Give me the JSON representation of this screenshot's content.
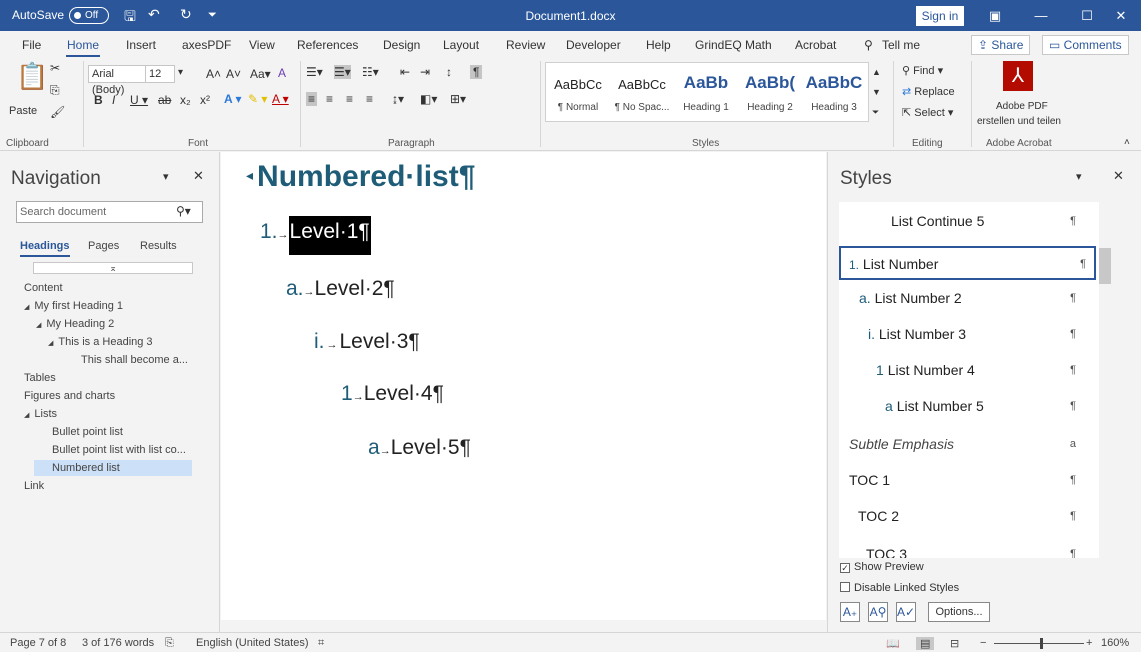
{
  "titlebar": {
    "autosave_label": "AutoSave",
    "autosave_state": "Off",
    "document_title": "Document1.docx",
    "sign_in": "Sign in"
  },
  "tabs": [
    "File",
    "Home",
    "Insert",
    "axesPDF",
    "View",
    "References",
    "Design",
    "Layout",
    "Review",
    "Developer",
    "Help",
    "GrindEQ Math",
    "Acrobat",
    "Tell me"
  ],
  "share_label": "Share",
  "comments_label": "Comments",
  "ribbon": {
    "paste": "Paste",
    "font_name": "Arial (Body)",
    "font_size": "12",
    "groups": {
      "clipboard": "Clipboard",
      "font": "Font",
      "paragraph": "Paragraph",
      "styles": "Styles",
      "editing": "Editing",
      "acrobat": "Adobe Acrobat"
    },
    "style_gallery": [
      {
        "preview": "AaBbCc",
        "name": "¶ Normal",
        "heading": false
      },
      {
        "preview": "AaBbCc",
        "name": "¶ No Spac...",
        "heading": false
      },
      {
        "preview": "AaBb",
        "name": "Heading 1",
        "heading": true
      },
      {
        "preview": "AaBb(",
        "name": "Heading 2",
        "heading": true
      },
      {
        "preview": "AaBbC",
        "name": "Heading 3",
        "heading": true
      }
    ],
    "find": "Find",
    "replace": "Replace",
    "select": "Select",
    "adobe_pdf_line1": "Adobe PDF",
    "adobe_pdf_line2": "erstellen und teilen"
  },
  "navigation": {
    "title": "Navigation",
    "search_placeholder": "Search document",
    "tabs": [
      "Headings",
      "Pages",
      "Results"
    ],
    "tree": [
      {
        "label": "Content",
        "level": 0,
        "arrow": "",
        "selected": false
      },
      {
        "label": "My first Heading 1",
        "level": 0,
        "arrow": "◢",
        "selected": false
      },
      {
        "label": "My Heading 2",
        "level": 1,
        "arrow": "◢",
        "selected": false
      },
      {
        "label": "This is a Heading 3",
        "level": 2,
        "arrow": "◢",
        "selected": false
      },
      {
        "label": "This shall become a...",
        "level": 3,
        "arrow": "",
        "selected": false
      },
      {
        "label": "Tables",
        "level": 0,
        "arrow": "",
        "selected": false
      },
      {
        "label": "Figures and charts",
        "level": 0,
        "arrow": "",
        "selected": false
      },
      {
        "label": "Lists",
        "level": 0,
        "arrow": "◢",
        "selected": false
      },
      {
        "label": "Bullet point list",
        "level": 1,
        "arrow": "",
        "selected": false
      },
      {
        "label": "Bullet point list with list co...",
        "level": 1,
        "arrow": "",
        "selected": false
      },
      {
        "label": "Numbered list",
        "level": 1,
        "arrow": "",
        "selected": true
      },
      {
        "label": "Link",
        "level": 0,
        "arrow": "",
        "selected": false
      }
    ]
  },
  "document": {
    "heading": "Numbered·list¶",
    "list": [
      {
        "num": "1.",
        "tab": "→",
        "text": "Level·1¶",
        "highlight": true
      },
      {
        "num": "a.",
        "tab": "→",
        "text": "Level·2¶",
        "highlight": false
      },
      {
        "num": "i.",
        "tab": "→",
        "text": "Level·3¶",
        "highlight": false
      },
      {
        "num": "1",
        "tab": "→",
        "text": "Level·4¶",
        "highlight": false
      },
      {
        "num": "a",
        "tab": "→",
        "text": "Level·5¶",
        "highlight": false
      }
    ]
  },
  "styles_pane": {
    "title": "Styles",
    "items": [
      {
        "num": "",
        "label": "List Continue 5",
        "mark": "¶",
        "italic": false,
        "selected": false
      },
      {
        "num": "1.",
        "label": "List Number",
        "mark": "¶",
        "italic": false,
        "selected": true
      },
      {
        "num": "a.",
        "label": "List Number 2",
        "mark": "¶",
        "italic": false,
        "selected": false
      },
      {
        "num": "i.",
        "label": "List Number 3",
        "mark": "¶",
        "italic": false,
        "selected": false
      },
      {
        "num": "1",
        "label": "List Number 4",
        "mark": "¶",
        "italic": false,
        "selected": false
      },
      {
        "num": "a",
        "label": "List Number 5",
        "mark": "¶",
        "italic": false,
        "selected": false
      },
      {
        "num": "",
        "label": "Subtle Emphasis",
        "mark": "a",
        "italic": true,
        "selected": false
      },
      {
        "num": "",
        "label": "TOC 1",
        "mark": "¶",
        "italic": false,
        "selected": false
      },
      {
        "num": "",
        "label": "TOC 2",
        "mark": "¶",
        "italic": false,
        "selected": false
      },
      {
        "num": "",
        "label": "TOC 3",
        "mark": "¶",
        "italic": false,
        "selected": false
      }
    ],
    "show_preview": "Show Preview",
    "show_preview_checked": true,
    "disable_linked": "Disable Linked Styles",
    "disable_linked_checked": false,
    "options": "Options..."
  },
  "statusbar": {
    "page": "Page 7 of 8",
    "words": "3 of 176 words",
    "language": "English (United States)",
    "zoom": "160%"
  }
}
